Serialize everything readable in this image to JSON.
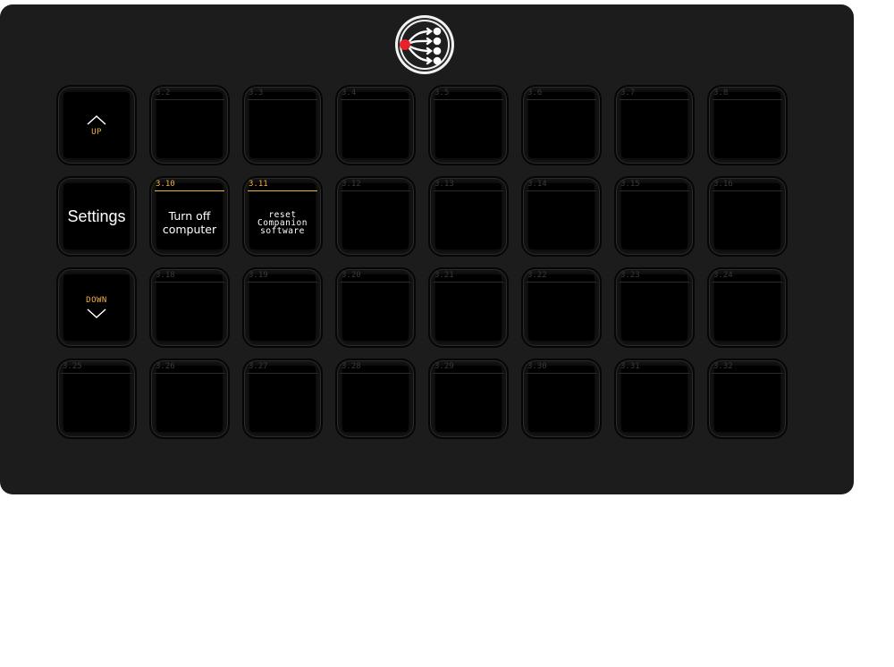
{
  "app": {
    "logo_icon": "companion-logo-icon"
  },
  "colors": {
    "panel": "#1c1c1c",
    "key_face": "#000000",
    "accent": "#f0b040",
    "text": "#ffffff",
    "logo_dot": "#e8202a"
  },
  "keys": [
    {
      "id": "3.1",
      "num": "",
      "type": "nav-up",
      "text": "UP",
      "icon": "chevron-up-icon"
    },
    {
      "id": "3.2",
      "num": "3.2",
      "type": "empty"
    },
    {
      "id": "3.3",
      "num": "3.3",
      "type": "empty"
    },
    {
      "id": "3.4",
      "num": "3.4",
      "type": "empty"
    },
    {
      "id": "3.5",
      "num": "3.5",
      "type": "empty"
    },
    {
      "id": "3.6",
      "num": "3.6",
      "type": "empty"
    },
    {
      "id": "3.7",
      "num": "3.7",
      "type": "empty"
    },
    {
      "id": "3.8",
      "num": "3.8",
      "type": "empty"
    },
    {
      "id": "3.9",
      "num": "",
      "type": "page",
      "text": "Settings"
    },
    {
      "id": "3.10",
      "num": "3.10",
      "type": "button",
      "text": "Turn off\ncomputer",
      "size": "med"
    },
    {
      "id": "3.11",
      "num": "3.11",
      "type": "button",
      "text": "reset\nCompanion\nsoftware",
      "size": "small"
    },
    {
      "id": "3.12",
      "num": "3.12",
      "type": "empty"
    },
    {
      "id": "3.13",
      "num": "3.13",
      "type": "empty"
    },
    {
      "id": "3.14",
      "num": "3.14",
      "type": "empty"
    },
    {
      "id": "3.15",
      "num": "3.15",
      "type": "empty"
    },
    {
      "id": "3.16",
      "num": "3.16",
      "type": "empty"
    },
    {
      "id": "3.17",
      "num": "",
      "type": "nav-down",
      "text": "DOWN",
      "icon": "chevron-down-icon"
    },
    {
      "id": "3.18",
      "num": "3.18",
      "type": "empty"
    },
    {
      "id": "3.19",
      "num": "3.19",
      "type": "empty"
    },
    {
      "id": "3.20",
      "num": "3.20",
      "type": "empty"
    },
    {
      "id": "3.21",
      "num": "3.21",
      "type": "empty"
    },
    {
      "id": "3.22",
      "num": "3.22",
      "type": "empty"
    },
    {
      "id": "3.23",
      "num": "3.23",
      "type": "empty"
    },
    {
      "id": "3.24",
      "num": "3.24",
      "type": "empty"
    },
    {
      "id": "3.25",
      "num": "3.25",
      "type": "empty"
    },
    {
      "id": "3.26",
      "num": "3.26",
      "type": "empty"
    },
    {
      "id": "3.27",
      "num": "3.27",
      "type": "empty"
    },
    {
      "id": "3.28",
      "num": "3.28",
      "type": "empty"
    },
    {
      "id": "3.29",
      "num": "3.29",
      "type": "empty"
    },
    {
      "id": "3.30",
      "num": "3.30",
      "type": "empty"
    },
    {
      "id": "3.31",
      "num": "3.31",
      "type": "empty"
    },
    {
      "id": "3.32",
      "num": "3.32",
      "type": "empty"
    }
  ]
}
